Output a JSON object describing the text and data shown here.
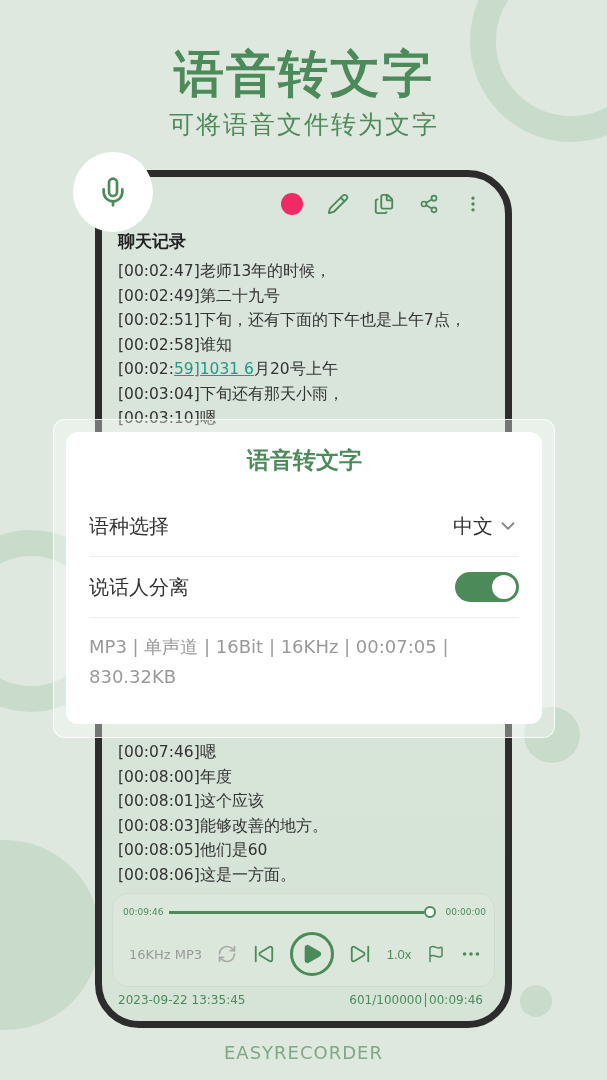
{
  "headline": "语音转文字",
  "subheadline": "可将语音文件转为文字",
  "app_screen": {
    "title": "聊天记录",
    "lines_top": [
      {
        "text": "[00:02:47]老师13年的时候，"
      },
      {
        "text": "[00:02:49]第二十九号"
      },
      {
        "text": "[00:02:51]下旬，还有下面的下午也是上午7点，"
      },
      {
        "text": "[00:02:58]谁知"
      },
      {
        "text": "[00:02:",
        "link": "59]1031 6",
        "rest": "月20号上午"
      },
      {
        "text": "[00:03:04]下旬还有那天小雨，"
      },
      {
        "text": "[00:03:10]嗯"
      }
    ],
    "lines_bottom": [
      {
        "text": "[00:07:46]嗯"
      },
      {
        "text": "[00:08:00]年度"
      },
      {
        "text": "[00:08:01]这个应该"
      },
      {
        "text": "[00:08:03]能够改善的地方。"
      },
      {
        "text": "[00:08:05]他们是60"
      },
      {
        "text": "[00:08:06]这是一方面。"
      }
    ],
    "player": {
      "elapsed": "00:09:46",
      "remaining": "00:00:00",
      "level": 1,
      "format": "16KHz MP3",
      "speed": "1.0x"
    },
    "footer": {
      "date": "2023-09-22  13:35:45",
      "count": "601/100000",
      "duration": "00:09:46"
    }
  },
  "dialog": {
    "title": "语音转文字",
    "language_label": "语种选择",
    "language_value": "中文",
    "speaker_label": "说话人分离",
    "speaker_separation": {
      "on": true
    },
    "info": "MP3 | 单声道 | 16Bit | 16KHz | 00:07:05 | 830.32KB"
  },
  "brand": "EASYRECORDER"
}
